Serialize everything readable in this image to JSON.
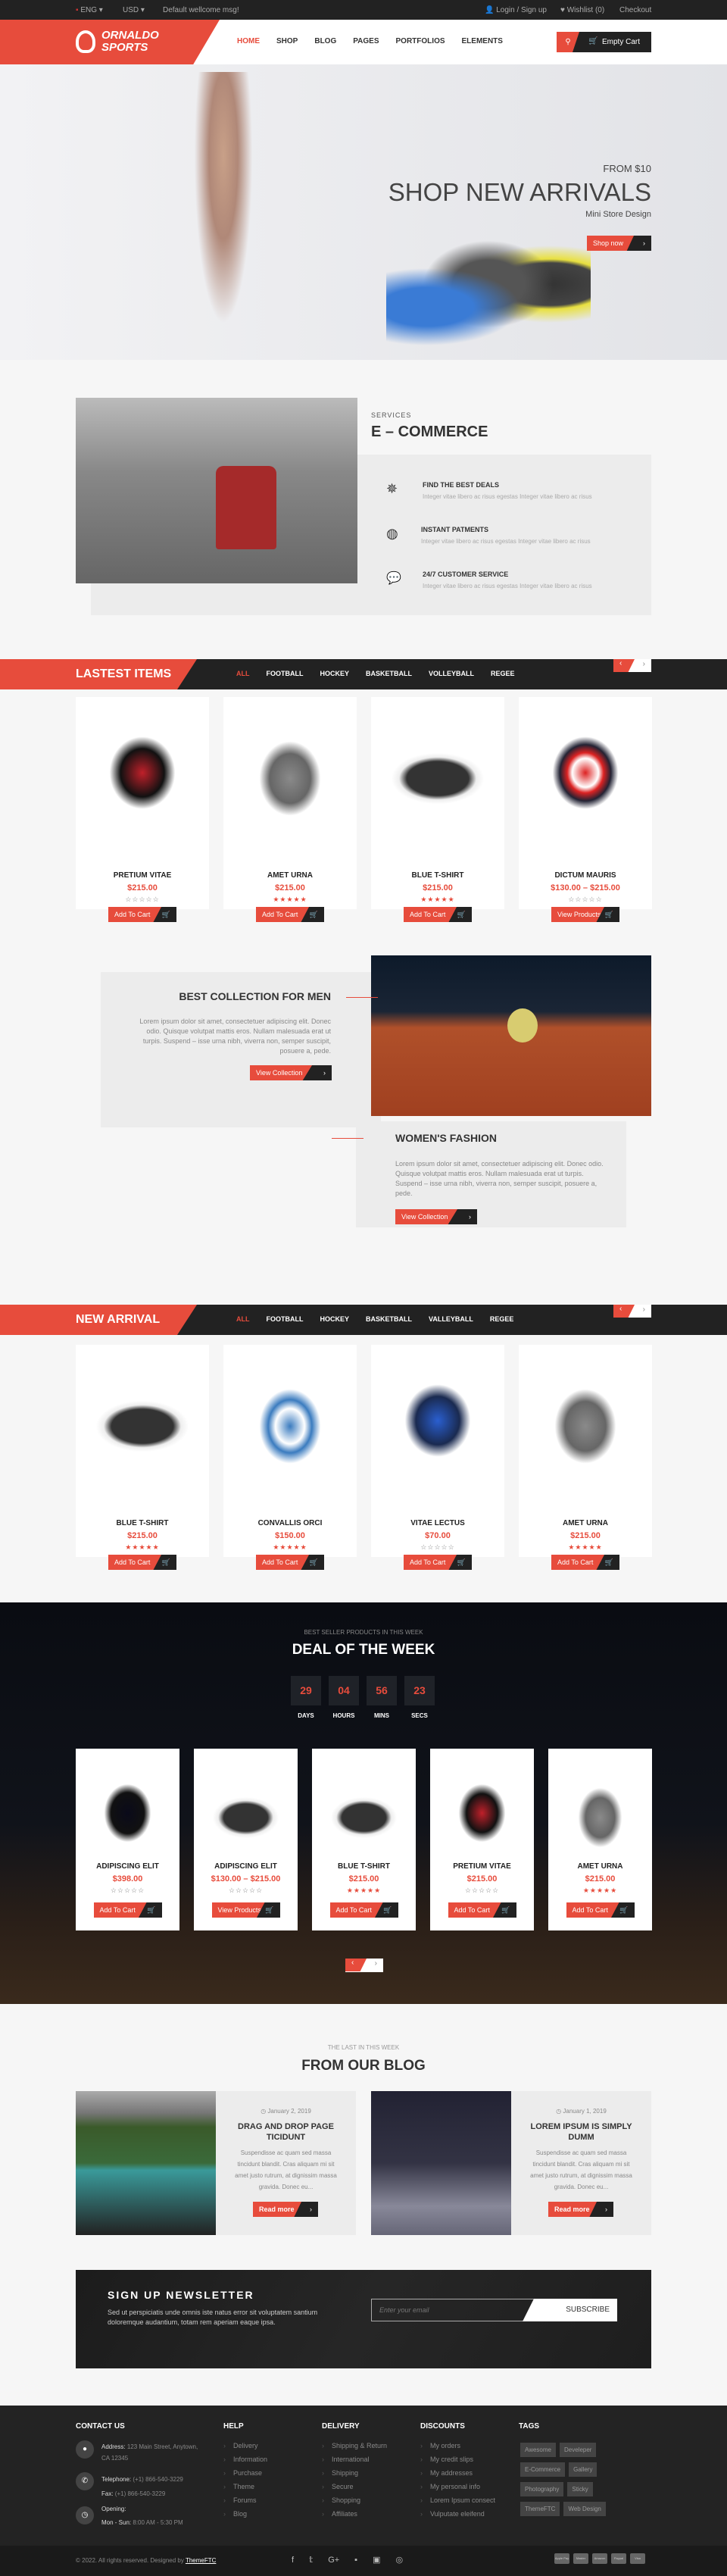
{
  "topbar": {
    "language": "ENG",
    "currency": "USD",
    "welcome": "Default wellcome msg!",
    "login": "Login / Sign up",
    "wishlist": "Wishlist (0)",
    "checkout": "Checkout"
  },
  "header": {
    "logo_line1": "ORNALDO",
    "logo_line2": "SPORTS",
    "nav": [
      "HOME",
      "SHOP",
      "BLOG",
      "PAGES",
      "PORTFOLIOS",
      "ELEMENTS"
    ],
    "cart": "Empty Cart"
  },
  "hero": {
    "from": "FROM $10",
    "title": "SHOP NEW ARRIVALS",
    "subtitle": "Mini Store Design",
    "button": "Shop now"
  },
  "services": {
    "kicker": "SERVICES",
    "title": "E – COMMERCE",
    "items": [
      {
        "title": "FIND THE BEST DEALS",
        "text": "Integer vitae libero ac risus egestas Integer vitae libero ac risus",
        "icon": "empire-icon"
      },
      {
        "title": "INSTANT PATMENTS",
        "text": "Integer vitae libero ac risus egestas Integer vitae libero ac risus",
        "icon": "basketball-icon"
      },
      {
        "title": "24/7 CUSTOMER SERVICE",
        "text": "Integer vitae libero ac risus egestas Integer vitae libero ac risus",
        "icon": "chat-icon"
      }
    ]
  },
  "latest": {
    "title": "LASTEST ITEMS",
    "tabs": [
      "ALL",
      "FOOTBALL",
      "HOCKEY",
      "BASKETBALL",
      "VOLLEYBALL",
      "REGEE"
    ],
    "products": [
      {
        "name": "PRETIUM VITAE",
        "price": "$215.00",
        "rating": 0,
        "button": "Add To Cart"
      },
      {
        "name": "AMET URNA",
        "price": "$215.00",
        "rating": 5,
        "button": "Add To Cart"
      },
      {
        "name": "BLUE T-SHIRT",
        "price": "$215.00",
        "rating": 5,
        "button": "Add To Cart"
      },
      {
        "name": "DICTUM MAURIS",
        "price": "$130.00 – $215.00",
        "rating": 0,
        "button": "View Products"
      }
    ]
  },
  "collections": {
    "men": {
      "title": "BEST COLLECTION FOR MEN",
      "text": "Lorem ipsum dolor sit amet, consectetuer adipiscing elit. Donec odio. Quisque volutpat mattis eros. Nullam malesuada erat ut turpis. Suspend – isse urna nibh, viverra non, semper suscipit, posuere a, pede.",
      "button": "View Collection"
    },
    "women": {
      "title": "WOMEN'S FASHION",
      "text": "Lorem ipsum dolor sit amet, consectetuer adipiscing elit. Donec odio. Quisque volutpat mattis eros. Nullam malesuada erat ut turpis. Suspend – isse urna nibh, viverra non, semper suscipit, posuere a, pede.",
      "button": "View Collection"
    }
  },
  "arrival": {
    "title": "NEW ARRIVAL",
    "tabs": [
      "ALL",
      "FOOTBALL",
      "HOCKEY",
      "BASKETBALL",
      "VALLEYBALL",
      "REGEE"
    ],
    "products": [
      {
        "name": "BLUE T-SHIRT",
        "price": "$215.00",
        "rating": 5,
        "button": "Add To Cart"
      },
      {
        "name": "CONVALLIS ORCI",
        "price": "$150.00",
        "rating": 5,
        "button": "Add To Cart"
      },
      {
        "name": "VITAE LECTUS",
        "price": "$70.00",
        "rating": 0,
        "button": "Add To Cart"
      },
      {
        "name": "AMET URNA",
        "price": "$215.00",
        "rating": 5,
        "button": "Add To Cart"
      }
    ]
  },
  "deal": {
    "kicker": "BEST SELLER PRODUCTS IN THIS WEEK",
    "title": "DEAL OF THE WEEK",
    "countdown": [
      {
        "value": "29",
        "label": "DAYS"
      },
      {
        "value": "04",
        "label": "HOURS"
      },
      {
        "value": "56",
        "label": "MINS"
      },
      {
        "value": "23",
        "label": "SECS"
      }
    ],
    "products": [
      {
        "name": "ADIPISCING ELIT",
        "price": "$398.00",
        "rating": 0,
        "button": "Add To Cart"
      },
      {
        "name": "ADIPISCING ELIT",
        "price": "$130.00 – $215.00",
        "rating": 0,
        "button": "View Products"
      },
      {
        "name": "BLUE T-SHIRT",
        "price": "$215.00",
        "rating": 5,
        "button": "Add To Cart"
      },
      {
        "name": "PRETIUM VITAE",
        "price": "$215.00",
        "rating": 0,
        "button": "Add To Cart"
      },
      {
        "name": "AMET URNA",
        "price": "$215.00",
        "rating": 5,
        "button": "Add To Cart"
      }
    ]
  },
  "blog": {
    "kicker": "THE LAST IN THIS WEEK",
    "title": "FROM OUR BLOG",
    "posts": [
      {
        "date": "January 2, 2019",
        "title": "DRAG AND DROP PAGE TICIDUNT",
        "text": "Suspendisse ac quam sed massa tincidunt blandit. Cras aliquam mi sit amet justo rutrum, at dignissim massa gravida. Donec eu...",
        "button": "Read more"
      },
      {
        "date": "January 1, 2019",
        "title": "LOREM IPSUM IS SIMPLY DUMM",
        "text": "Suspendisse ac quam sed massa tincidunt blandit. Cras aliquam mi sit amet justo rutrum, at dignissim massa gravida. Donec eu...",
        "button": "Read more"
      }
    ]
  },
  "newsletter": {
    "title": "SIGN UP NEWSLETTER",
    "text": "Sed ut perspiciatis unde omnis iste natus error sit voluptatem santium doloremque audantium, totam rem aperiam eaque ipsa.",
    "placeholder": "Enter your email",
    "button": "SUBSCRIBE"
  },
  "footer": {
    "contact": {
      "title": "CONTACT US",
      "address_label": "Address:",
      "address": "123 Main Street, Anytown, CA 12345",
      "phone_label": "Telephone:",
      "phone": "(+1) 866-540-3229",
      "fax_label": "Fax:",
      "fax": "(+1) 866-540-3229",
      "opening_label": "Opening:",
      "hours_label": "Mon - Sun:",
      "hours": "8:00 AM - 5:30 PM"
    },
    "help": {
      "title": "HELP",
      "links": [
        "Delivery",
        "Information",
        "Purchase",
        "Theme",
        "Forums",
        "Blog"
      ]
    },
    "delivery": {
      "title": "DELIVERY",
      "links": [
        "Shipping & Return",
        "International",
        "Shipping",
        "Secure",
        "Shopping",
        "Affiliates"
      ]
    },
    "discounts": {
      "title": "DISCOUNTS",
      "links": [
        "My orders",
        "My credit slips",
        "My addresses",
        "My personal info",
        "Lorem Ipsum consect",
        "Vulputate eleifend"
      ]
    },
    "tags": {
      "title": "TAGS",
      "items": [
        "Awesome",
        "Develeper",
        "E-Commerce",
        "Gallery",
        "Photography",
        "Sticky",
        "ThemeFTC",
        "Web Design"
      ]
    },
    "copyright": "© 2022. All rights reserved. Designed by",
    "designer": "ThemeFTC",
    "social": [
      "facebook-icon",
      "twitter-icon",
      "google-plus-icon",
      "flickr-icon",
      "youtube-icon",
      "instagram-icon"
    ],
    "payments": [
      "Apple Pay",
      "Master Card",
      "Amazon",
      "Paypal",
      "Visa"
    ]
  },
  "colors": {
    "accent": "#e74c3c",
    "dark": "#222222"
  }
}
